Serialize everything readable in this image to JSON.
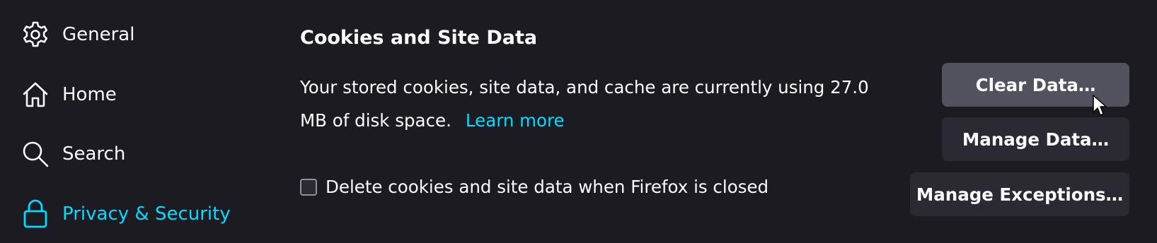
{
  "sidebar": {
    "items": [
      {
        "label": "General",
        "icon": "gear-icon"
      },
      {
        "label": "Home",
        "icon": "home-icon"
      },
      {
        "label": "Search",
        "icon": "search-icon"
      },
      {
        "label": "Privacy & Security",
        "icon": "lock-icon",
        "selected": true
      }
    ]
  },
  "section": {
    "title": "Cookies and Site Data",
    "description": "Your stored cookies, site data, and cache are currently using 27.0 MB of disk space.",
    "learn_more": "Learn more",
    "checkbox_label": "Delete cookies and site data when Firefox is closed",
    "checkbox_checked": false
  },
  "buttons": {
    "clear_data": "Clear Data…",
    "manage_data": "Manage Data…",
    "manage_exceptions": "Manage Exceptions…"
  },
  "colors": {
    "background": "#1c1b22",
    "accent": "#00ddff",
    "button": "#2b2a33",
    "button_hover": "#52525e",
    "text": "#fbfbfe"
  }
}
